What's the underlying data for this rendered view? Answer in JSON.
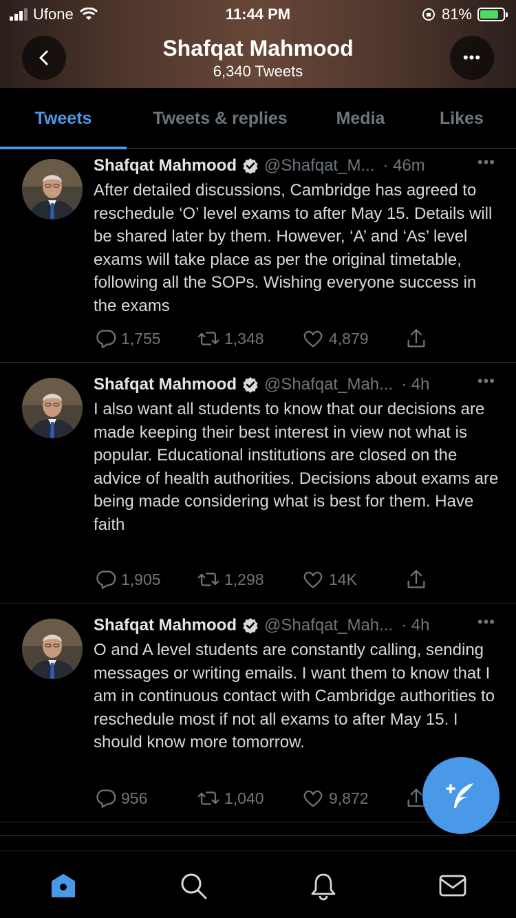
{
  "status_bar": {
    "carrier": "Ufone",
    "time": "11:44 PM",
    "battery_percent": "81%",
    "battery_level": 0.81
  },
  "header": {
    "name": "Shafqat Mahmood",
    "tweet_count": "6,340 Tweets",
    "more_label": "•••"
  },
  "tabs": [
    {
      "label": "Tweets",
      "active": true
    },
    {
      "label": "Tweets & replies",
      "active": false
    },
    {
      "label": "Media",
      "active": false
    },
    {
      "label": "Likes",
      "active": false
    }
  ],
  "tweets": [
    {
      "name": "Shafqat Mahmood",
      "handle": "@Shafqat_M...",
      "time": "· 46m",
      "text": "After detailed discussions, Cambridge has agreed to reschedule ‘O’ level exams to after May 15. Details will be shared later by them. However, ‘A’ and ‘As’ level exams will take place as per the original timetable, following all the SOPs. Wishing everyone success in the exams",
      "replies": "1,755",
      "retweets": "1,348",
      "likes": "4,879"
    },
    {
      "name": "Shafqat Mahmood",
      "handle": "@Shafqat_Mah...",
      "time": "· 4h",
      "text": "I also want all students to know that our decisions are made keeping their best interest in view not what is popular. Educational institutions are closed on the advice of health authorities. Decisions about exams are being made considering what is best for them. Have faith",
      "replies": "1,905",
      "retweets": "1,298",
      "likes": "14K"
    },
    {
      "name": "Shafqat Mahmood",
      "handle": "@Shafqat_Mah...",
      "time": "· 4h",
      "text": "O and A level students are constantly calling, sending messages or writing emails. I want them to know that I am in continuous contact with Cambridge authorities to reschedule most if not all exams to after May 15. I should know more tomorrow.",
      "replies": "956",
      "retweets": "1,040",
      "likes": "9,872"
    }
  ],
  "icons": {
    "back": "chevron-left-icon",
    "more": "more-icon",
    "verified": "verified-badge-icon",
    "reply": "reply-icon",
    "retweet": "retweet-icon",
    "like": "heart-icon",
    "share": "share-icon",
    "compose": "compose-tweet-icon",
    "home": "home-icon",
    "search": "search-icon",
    "notifications": "bell-icon",
    "messages": "mail-icon"
  },
  "colors": {
    "accent": "#4a99e9",
    "background": "#000000",
    "muted": "#6e767d",
    "text": "#d9d9d9"
  },
  "active_nav": "home"
}
